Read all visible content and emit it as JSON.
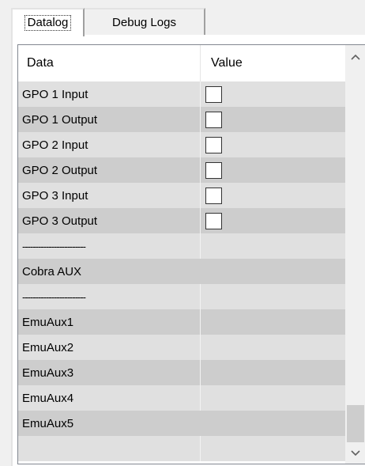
{
  "tabs": [
    {
      "label": "Datalog",
      "active": true
    },
    {
      "label": "Debug Logs",
      "active": false
    }
  ],
  "grid": {
    "columns": [
      "Data",
      "Value"
    ],
    "rows": [
      {
        "data": "GPO 1 Input",
        "checkbox": true,
        "checked": false
      },
      {
        "data": "GPO 1 Output",
        "checkbox": true,
        "checked": false
      },
      {
        "data": "GPO 2 Input",
        "checkbox": true,
        "checked": false
      },
      {
        "data": "GPO 2 Output",
        "checkbox": true,
        "checked": false
      },
      {
        "data": "GPO 3 Input",
        "checkbox": true,
        "checked": false
      },
      {
        "data": "GPO 3 Output",
        "checkbox": true,
        "checked": false
      },
      {
        "data": "------------------------",
        "checkbox": false,
        "separator": true
      },
      {
        "data": "Cobra AUX",
        "checkbox": false,
        "wide": true
      },
      {
        "data": "------------------------",
        "checkbox": false,
        "separator": true
      },
      {
        "data": "EmuAux1",
        "checkbox": false
      },
      {
        "data": "EmuAux2",
        "checkbox": false
      },
      {
        "data": "EmuAux3",
        "checkbox": false
      },
      {
        "data": "EmuAux4",
        "checkbox": false
      },
      {
        "data": "EmuAux5",
        "checkbox": false,
        "wide": true
      },
      {
        "data": "",
        "checkbox": false
      }
    ]
  },
  "scrollbar": {
    "up_icon": "chevron-up-icon",
    "down_icon": "chevron-down-icon",
    "position_fraction": 0.95
  },
  "colors": {
    "row_light": "#e0e0e0",
    "row_dark": "#cdcdcd",
    "grid_border": "#828790"
  }
}
